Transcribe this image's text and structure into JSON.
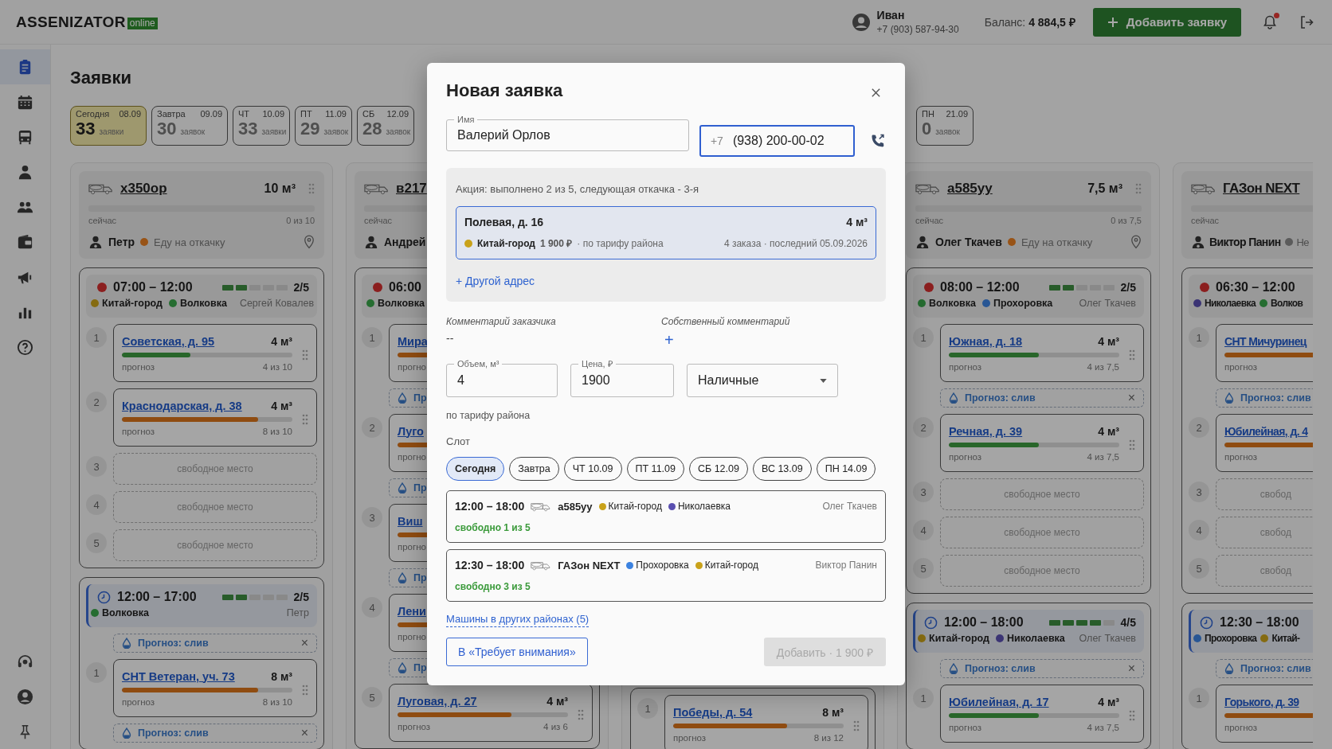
{
  "header": {
    "logo": "ASSENIZATOR",
    "logo_badge": "online",
    "user": {
      "name": "Иван",
      "phone": "+7 (903) 587-94-30"
    },
    "balance": "Баланс: **4 884,5 ₽**",
    "add_button": "Добавить заявку",
    "notifications": {
      "unread": true
    }
  },
  "sidebar": {
    "items": [
      {
        "selected": true
      },
      {
        "selected": false
      },
      {
        "selected": false
      },
      {
        "selected": false
      },
      {
        "selected": false
      },
      {
        "selected": false
      },
      {
        "selected": false
      },
      {
        "selected": false
      },
      {
        "selected": false
      }
    ]
  },
  "page": {
    "title": "Заявки"
  },
  "days": [
    {
      "day": "Сегодня",
      "date": "08.09",
      "count": "33",
      "unit": "заявки",
      "selected": true
    },
    {
      "day": "Завтра",
      "date": "09.09",
      "count": "30",
      "unit": "заявок",
      "selected": false
    },
    {
      "day": "ЧТ",
      "date": "10.09",
      "count": "33",
      "unit": "заявки",
      "selected": false
    },
    {
      "day": "ПТ",
      "date": "11.09",
      "count": "29",
      "unit": "заявок",
      "selected": false
    },
    {
      "day": "СБ",
      "date": "12.09",
      "count": "28",
      "unit": "заявок",
      "selected": false
    }
  ],
  "days_more": [
    {
      "day": "ПН",
      "date": "21.09",
      "count": "0",
      "unit": "заявок",
      "selected": false
    }
  ],
  "columns": [
    {
      "vehicle": "х350ор",
      "capacity": "10 м³",
      "fill": {
        "level": 0,
        "label": "сейчас",
        "reading": "0 из 10"
      },
      "driver": "Петр",
      "status": {
        "text": "Еду на откачку",
        "color": "#985316"
      },
      "trips": [
        {
          "kind": "active",
          "time": "07:00 – 12:00",
          "load": {
            "level": 0.4,
            "reading": "2/5"
          },
          "districts": [
            {
              "name": "Китай-город",
              "color": "#856b11"
            },
            {
              "name": "Волковка",
              "color": "#266d31"
            }
          ],
          "driver": "Сергей Ковалев",
          "items": [
            {
              "kind": "order",
              "number": "1",
              "address": "Советская, д. 95",
              "volume": "4 м³",
              "level": 0.4,
              "label": "прогноз",
              "reading": "4 из 10",
              "draggable": true
            },
            {
              "kind": "order",
              "number": "2",
              "address": "Краснодарская, д. 38",
              "volume": "4 м³",
              "level": 0.8,
              "label": "прогноз",
              "reading": "8 из 10",
              "draggable": true
            },
            {
              "kind": "free",
              "number": "3",
              "text": "свободное место"
            },
            {
              "kind": "free",
              "number": "4",
              "text": "свободное место"
            },
            {
              "kind": "free",
              "number": "5",
              "text": "свободное место"
            }
          ]
        },
        {
          "kind": "planned",
          "time": "12:00 – 17:00",
          "load": {
            "level": 0.4,
            "reading": "2/5"
          },
          "districts": [
            {
              "name": "Волковка",
              "color": "#266d31"
            }
          ],
          "driver": "Петр",
          "items": [
            {
              "kind": "forecast",
              "text": "Прогноз: слив",
              "close": "×"
            },
            {
              "kind": "order",
              "number": "1",
              "address": "СНТ Ветеран, уч. 73",
              "volume": "8 м³",
              "level": 0.8,
              "label": "прогноз",
              "reading": "8 из 10",
              "draggable": true
            },
            {
              "kind": "forecast",
              "text": "Прогноз: слив",
              "close": "×"
            }
          ]
        }
      ]
    },
    {
      "vehicle": "в217",
      "fill": {
        "level": 0,
        "label": "сейчас"
      },
      "driver": "Андрей",
      "trips": [
        {
          "kind": "active",
          "time": "06:00",
          "districts": [
            {
              "name": "Волковка",
              "color": "#266d31"
            }
          ],
          "items": [
            {
              "kind": "order",
              "number": "1",
              "address": "Мира",
              "level": 0.8,
              "label": "прогно",
              "draggable": false
            },
            {
              "kind": "forecast",
              "text": "Пр"
            },
            {
              "kind": "order",
              "number": "2",
              "address": "Луго",
              "level": 0.8,
              "label": "прогно",
              "draggable": false
            },
            {
              "kind": "forecast",
              "text": "Пр"
            },
            {
              "kind": "order",
              "number": "3",
              "address": "Виш",
              "level": 0.8,
              "label": "прогно",
              "draggable": false
            },
            {
              "kind": "forecast",
              "text": "Пр"
            },
            {
              "kind": "order",
              "number": "4",
              "address": "Лени",
              "level": 0.8,
              "label": "прогно",
              "draggable": false
            },
            {
              "kind": "forecast",
              "text": "Пр"
            },
            {
              "kind": "order",
              "number": "5",
              "address": "Луговая, д. 27",
              "volume": "4 м³",
              "level": 0.67,
              "label": "прогноз",
              "reading": "4 из 6",
              "draggable": true
            }
          ]
        }
      ]
    },
    {
      "trips": [
        {
          "items": [
            {
              "kind": "order",
              "number": "1",
              "address": "Победы, д. 54",
              "volume": "8 м³",
              "level": 0.67,
              "label": "прогноз",
              "reading": "8 из 12",
              "draggable": true
            }
          ]
        }
      ]
    },
    {
      "vehicle": "а585уу",
      "capacity": "7,5 м³",
      "fill": {
        "level": 0,
        "label": "сейчас",
        "reading": "0 из 7,5"
      },
      "driver": "Олег Ткачев",
      "status": {
        "text": "Еду на откачку",
        "color": "#985316"
      },
      "trips": [
        {
          "kind": "active",
          "time": "08:00 – 12:00",
          "load": {
            "level": 0.4,
            "reading": "2/5"
          },
          "districts": [
            {
              "name": "Волковка",
              "color": "#266d31"
            },
            {
              "name": "Прохоровка",
              "color": "#285694"
            }
          ],
          "driver": "Олег Ткачев",
          "items": [
            {
              "kind": "order",
              "number": "1",
              "address": "Южная, д. 18",
              "volume": "4 м³",
              "level": 0.53,
              "label": "прогноз",
              "reading": "4 из 7,5",
              "draggable": true
            },
            {
              "kind": "forecast",
              "text": "Прогноз: слив",
              "close": "×"
            },
            {
              "kind": "order",
              "number": "2",
              "address": "Речная, д. 39",
              "volume": "4 м³",
              "level": 0.53,
              "label": "прогноз",
              "reading": "4 из 7,5",
              "draggable": true
            },
            {
              "kind": "free",
              "number": "3",
              "text": "свободное место"
            },
            {
              "kind": "free",
              "number": "4",
              "text": "свободное место"
            },
            {
              "kind": "free",
              "number": "5",
              "text": "свободное место"
            }
          ]
        },
        {
          "kind": "planned",
          "time": "12:00 – 18:00",
          "load": {
            "level": 0.8,
            "reading": "4/5"
          },
          "districts": [
            {
              "name": "Китай-город",
              "color": "#856b11"
            },
            {
              "name": "Николаевка",
              "color": "#3b3474"
            }
          ],
          "driver": "Олег Ткачев",
          "items": [
            {
              "kind": "forecast",
              "text": "Прогноз: слив",
              "close": "×"
            },
            {
              "kind": "order",
              "number": "1",
              "address": "Юбилейная, д. 17",
              "volume": "4 м³",
              "level": 0.53,
              "label": "прогноз",
              "reading": "4 из 7,5",
              "draggable": true
            }
          ]
        }
      ]
    },
    {
      "vehicle": "ГАЗон NEXT",
      "fill": {
        "level": 0,
        "label": "сейчас"
      },
      "driver": "Виктор Панин",
      "status": {
        "text": "Не",
        "color": "#5b5b5b"
      },
      "trips": [
        {
          "kind": "active",
          "time": "06:30 – 12:00",
          "districts": [
            {
              "name": "Николаевка",
              "color": "#3b3474"
            },
            {
              "name": "Волков",
              "color": "#266d31"
            }
          ],
          "items": [
            {
              "kind": "order",
              "number": "1",
              "address": "СНТ Мичуринец",
              "level": 0.8,
              "label": "прогноз",
              "draggable": false
            },
            {
              "kind": "forecast",
              "text": "Прогноз: слив"
            },
            {
              "kind": "order",
              "number": "2",
              "address": "Юбилейная, д. 4",
              "level": 0.8,
              "label": "прогноз",
              "draggable": false
            },
            {
              "kind": "free",
              "number": "3",
              "text": "свобод"
            },
            {
              "kind": "free",
              "number": "4",
              "text": "свобод"
            },
            {
              "kind": "free",
              "number": "5",
              "text": "свобод"
            }
          ]
        },
        {
          "kind": "planned",
          "time": "12:30 – 18:00",
          "districts": [
            {
              "name": "Прохоровка",
              "color": "#285694"
            },
            {
              "name": "Китай-",
              "color": "#856b11"
            }
          ],
          "items": [
            {
              "kind": "forecast",
              "text": "Прогноз: слив"
            },
            {
              "kind": "order",
              "number": "1",
              "address": "Горького, д. 39",
              "level": 0.8,
              "label": "прогноз",
              "draggable": false
            }
          ]
        }
      ]
    }
  ],
  "modal": {
    "title": "Новая заявка",
    "name_field": {
      "label": "Имя",
      "value": "Валерий Орлов",
      "focused": false
    },
    "phone_field": {
      "prefix": "+7",
      "value": "(938) 200-00-02",
      "focused": true
    },
    "promo": "Акция: выполнено 2 из 5, следующая откачка - 3-я",
    "addresses": [
      {
        "title": "Полевая, д. 16",
        "volume": "4 м³",
        "district": {
          "name": "Китай-город",
          "color": "#c9a21a"
        },
        "price": "1 900 ₽",
        "tariff": "· по тарифу района",
        "history": "4 заказа · последний 05.09.2026",
        "selected": true
      }
    ],
    "other_address": "+ Другой адрес",
    "customer_comment": {
      "label": "Комментарий заказчика",
      "value": "--"
    },
    "own_comment": {
      "label": "Собственный комментарий",
      "add": "+"
    },
    "volume_field": {
      "label": "Объем, м³",
      "value": "4"
    },
    "price_field": {
      "label": "Цена, ₽",
      "value": "1900"
    },
    "payment_select": {
      "value": "Наличные"
    },
    "price_note": "по тарифу района",
    "slot_label": "Слот",
    "slot_days": [
      {
        "label": "Сегодня",
        "selected": true
      },
      {
        "label": "Завтра",
        "selected": false
      },
      {
        "label": "ЧТ 10.09",
        "selected": false
      },
      {
        "label": "ПТ 11.09",
        "selected": false
      },
      {
        "label": "СБ 12.09",
        "selected": false
      },
      {
        "label": "ВС 13.09",
        "selected": false
      },
      {
        "label": "ПН 14.09",
        "selected": false
      }
    ],
    "slots": [
      {
        "time": "12:00 – 18:00",
        "vehicle": "а585уу",
        "districts": [
          {
            "name": "Китай-город",
            "color": "#c9a21a"
          },
          {
            "name": "Николаевка",
            "color": "#5a4fb0"
          }
        ],
        "driver": "Олег Ткачев",
        "free": "свободно 1 из 5"
      },
      {
        "time": "12:30 – 18:00",
        "vehicle": "ГАЗон NEXT",
        "districts": [
          {
            "name": "Прохоровка",
            "color": "#3c82e0"
          },
          {
            "name": "Китай-город",
            "color": "#c9a21a"
          }
        ],
        "driver": "Виктор Панин",
        "free": "свободно 3 из 5"
      }
    ],
    "other_vehicles": "Машины в других районах (5)",
    "attention_button": "В «Требует внимания»",
    "submit_button": {
      "label": "Добавить · 1 900 ₽",
      "disabled": true
    }
  }
}
